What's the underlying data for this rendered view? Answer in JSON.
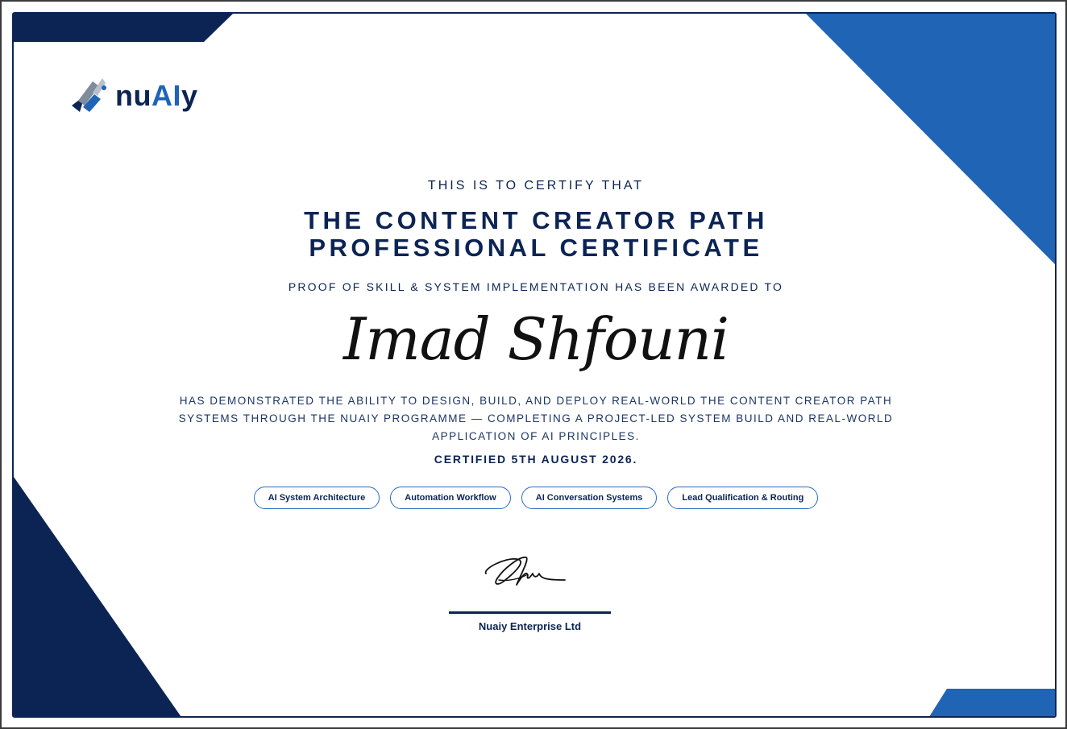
{
  "logo": {
    "brand_prefix": "nu",
    "brand_ai": "AI",
    "brand_suffix": "y",
    "icon": "nuaiy-logo-icon"
  },
  "certificate": {
    "intro": "THIS IS TO CERTIFY THAT",
    "title_line1": "THE CONTENT CREATOR PATH",
    "title_line2": "PROFESSIONAL CERTIFICATE",
    "awarded_text": "PROOF OF SKILL & SYSTEM IMPLEMENTATION HAS BEEN AWARDED TO",
    "recipient": "Imad Shfouni",
    "description": "HAS DEMONSTRATED THE ABILITY TO DESIGN, BUILD, AND DEPLOY REAL-WORLD THE CONTENT CREATOR PATH SYSTEMS THROUGH THE NUAIY PROGRAMME — COMPLETING A PROJECT-LED SYSTEM BUILD AND REAL-WORLD APPLICATION OF AI PRINCIPLES.",
    "certified_date": "CERTIFIED 5TH AUGUST 2026."
  },
  "skills": [
    "AI System Architecture",
    "Automation Workflow",
    "AI Conversation Systems",
    "Lead Qualification & Routing"
  ],
  "signature": {
    "signer": "Nuaiy Enterprise Ltd"
  },
  "colors": {
    "navy": "#0b2454",
    "blue": "#1f64b5",
    "ink": "#111111"
  }
}
